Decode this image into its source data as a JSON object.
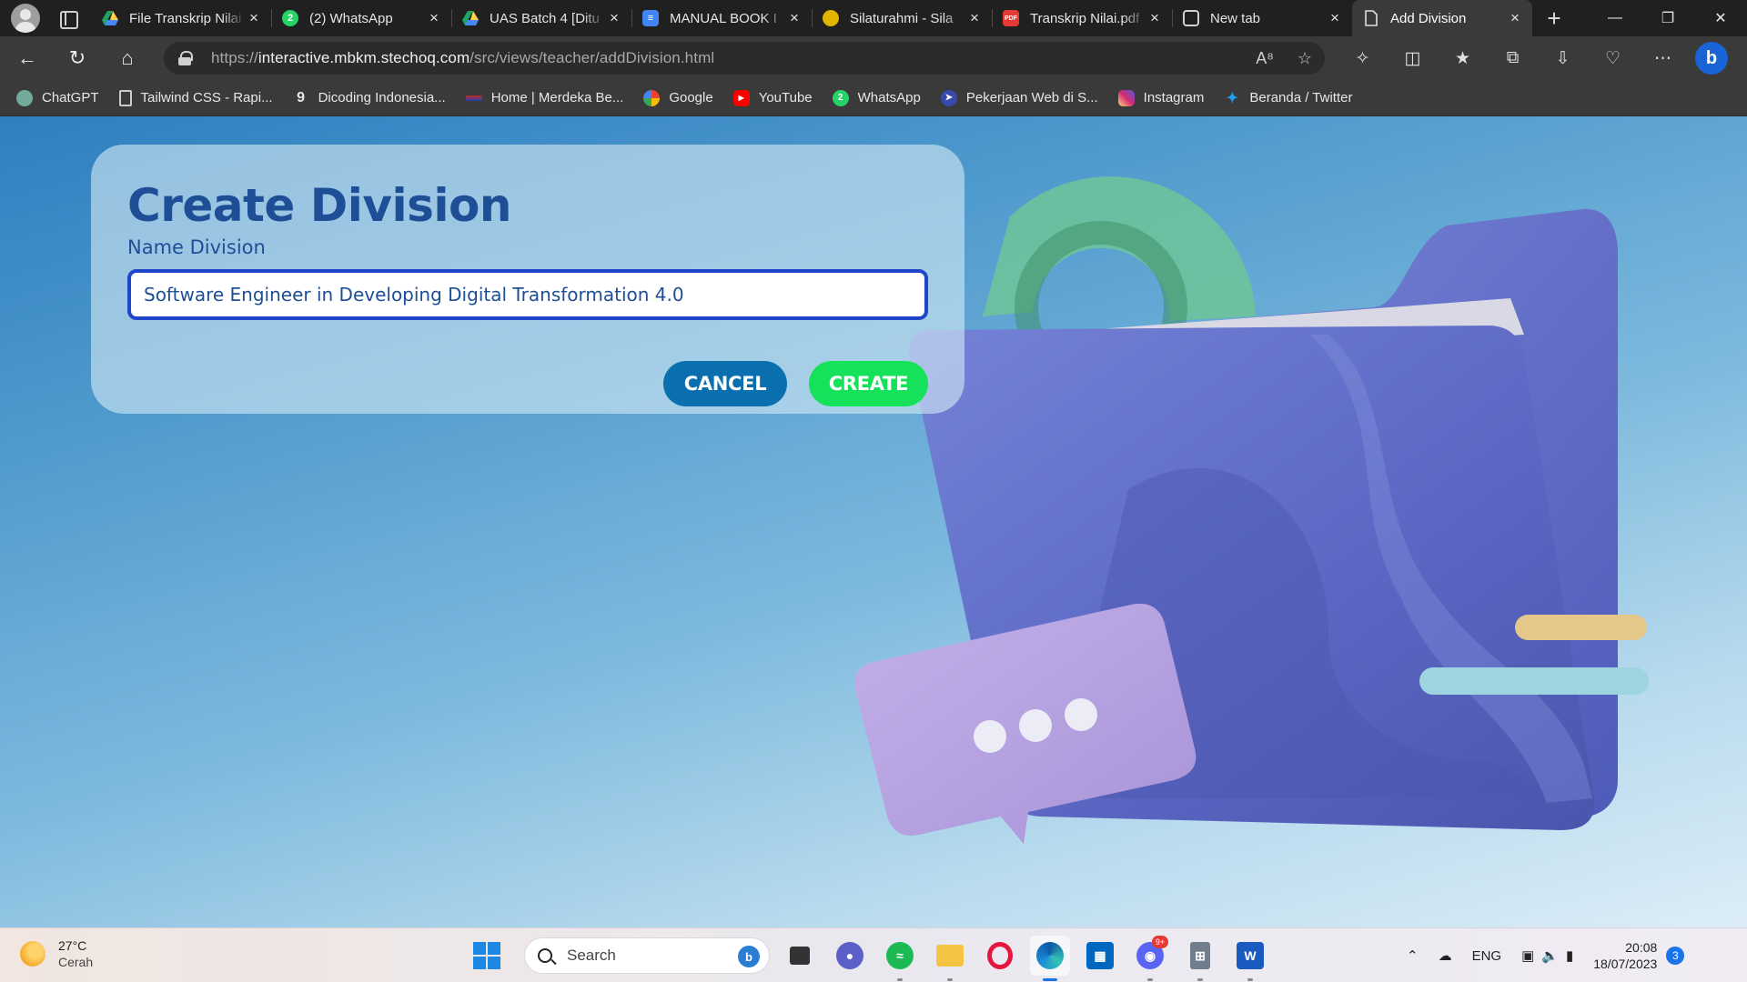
{
  "browser": {
    "tabs": [
      {
        "title": "File Transkrip Nilai",
        "favicon": "google-drive-icon",
        "active": false
      },
      {
        "title": "(2) WhatsApp",
        "favicon": "whatsapp-icon",
        "active": false
      },
      {
        "title": "UAS Batch 4 [Ditu",
        "favicon": "google-drive-icon",
        "active": false
      },
      {
        "title": "MANUAL BOOK I",
        "favicon": "google-docs-icon",
        "active": false
      },
      {
        "title": "Silaturahmi - Sila",
        "favicon": "university-crest-icon",
        "active": false
      },
      {
        "title": "Transkrip Nilai.pdf",
        "favicon": "pdf-icon",
        "active": false
      },
      {
        "title": "New tab",
        "favicon": "new-tab-icon",
        "active": false
      },
      {
        "title": "Add Division",
        "favicon": "page-icon",
        "active": true
      }
    ],
    "close_glyph": "×",
    "new_tab_glyph": "+",
    "url_prefix": "https://",
    "url_host": "interactive.mbkm.stechoq.com",
    "url_path": "/src/views/teacher/addDivision.html",
    "bookmarks": [
      {
        "label": "ChatGPT",
        "icon": "chatgpt-icon"
      },
      {
        "label": "Tailwind CSS - Rapi...",
        "icon": "page-icon"
      },
      {
        "label": "Dicoding Indonesia...",
        "icon": "dicoding-icon"
      },
      {
        "label": "Home | Merdeka Be...",
        "icon": "merdeka-icon"
      },
      {
        "label": "Google",
        "icon": "google-icon"
      },
      {
        "label": "YouTube",
        "icon": "youtube-icon"
      },
      {
        "label": "WhatsApp",
        "icon": "whatsapp-icon"
      },
      {
        "label": "Pekerjaan Web di S...",
        "icon": "job-icon"
      },
      {
        "label": "Instagram",
        "icon": "instagram-icon"
      },
      {
        "label": "Beranda / Twitter",
        "icon": "twitter-icon"
      }
    ]
  },
  "form": {
    "heading": "Create Division",
    "field_label": "Name Division",
    "field_value": "Software Engineer in Developing Digital Transformation 4.0",
    "cancel_label": "CANCEL",
    "create_label": "CREATE"
  },
  "taskbar": {
    "temperature": "27°C",
    "condition": "Cerah",
    "search_placeholder": "Search",
    "language": "ENG",
    "time": "20:08",
    "date": "18/07/2023",
    "notification_count": "3",
    "discord_badge": "9+"
  },
  "colors": {
    "heading": "#1e4f96",
    "input_border": "#1d46c9",
    "cancel_button": "#0a6fae",
    "create_button": "#16e15a"
  }
}
